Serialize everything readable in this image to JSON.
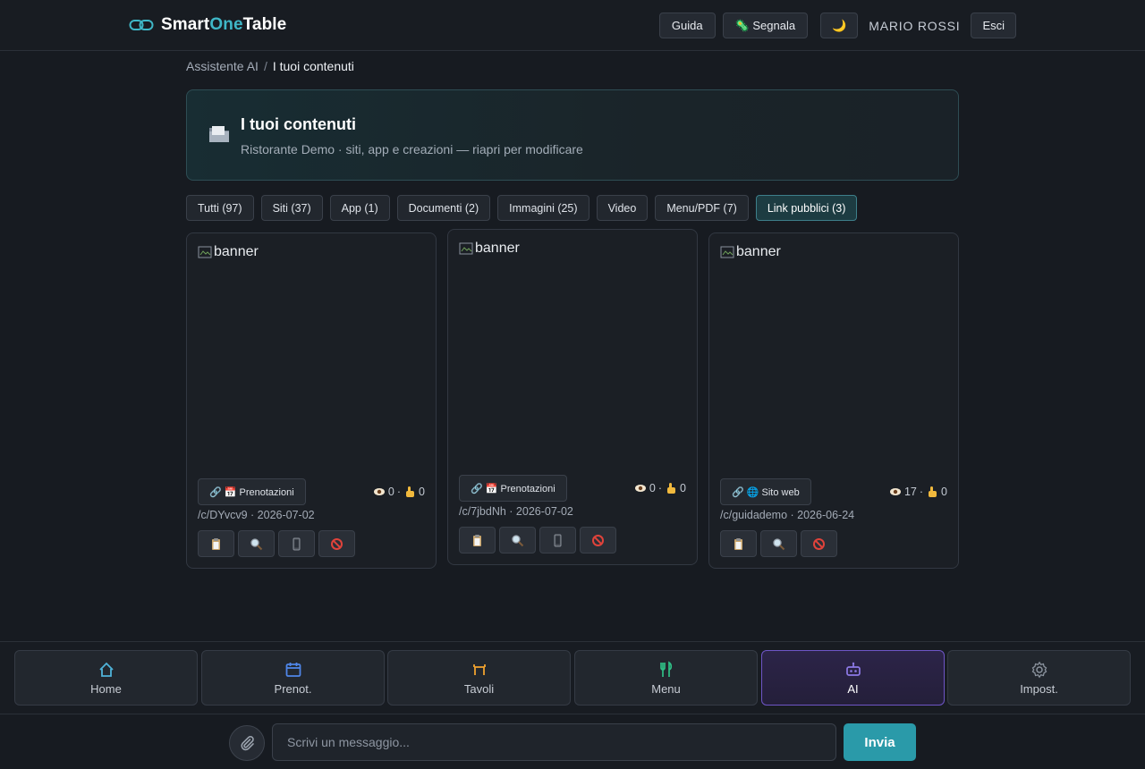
{
  "brand": {
    "part1": "Smart",
    "part2": "One",
    "part3": "Table",
    "logo_icon": "link-logo-icon"
  },
  "header": {
    "guide_label": "Guida",
    "report_label": "🦠 Segnala",
    "theme_icon": "🌙",
    "username": "MARIO ROSSI",
    "logout_label": "Esci"
  },
  "breadcrumb": {
    "parent": "Assistente AI",
    "separator": "/",
    "current": "I tuoi contenuti"
  },
  "hero": {
    "icon": "folder-icon",
    "title": "I tuoi contenuti",
    "subtitle": "Ristorante Demo · siti, app e creazioni — riapri per modificare"
  },
  "filters": [
    {
      "label": "Tutti (97)",
      "active": false
    },
    {
      "label": "Siti (37)",
      "active": false
    },
    {
      "label": "App (1)",
      "active": false
    },
    {
      "label": "Documenti (2)",
      "active": false
    },
    {
      "label": "Immagini (25)",
      "active": false
    },
    {
      "label": "Video",
      "active": false
    },
    {
      "label": "Menu/PDF (7)",
      "active": false
    },
    {
      "label": "Link pubblici (3)",
      "active": true
    }
  ],
  "cards": [
    {
      "banner_alt": "banner",
      "type_label": "🔗 📅 Prenotazioni",
      "views": "0",
      "clicks": "0",
      "stats_sep": "·",
      "meta": "/c/DYvcv9 · 2026-07-02",
      "actions": [
        "copy-icon",
        "preview-icon",
        "qr-icon",
        "disable-icon"
      ]
    },
    {
      "banner_alt": "banner",
      "type_label": "🔗 📅 Prenotazioni",
      "views": "0",
      "clicks": "0",
      "stats_sep": "·",
      "meta": "/c/7jbdNh · 2026-07-02",
      "actions": [
        "copy-icon",
        "preview-icon",
        "qr-icon",
        "disable-icon"
      ]
    },
    {
      "banner_alt": "banner",
      "type_label": "🔗 🌐 Sito web",
      "views": "17",
      "clicks": "0",
      "stats_sep": "·",
      "meta": "/c/guidademo · 2026-06-24",
      "actions": [
        "copy-icon",
        "preview-icon",
        "disable-icon"
      ]
    }
  ],
  "bottom_nav": [
    {
      "label": "Home",
      "icon": "home-icon",
      "active": false
    },
    {
      "label": "Prenot.",
      "icon": "calendar-icon",
      "active": false
    },
    {
      "label": "Tavoli",
      "icon": "table-icon",
      "active": false
    },
    {
      "label": "Menu",
      "icon": "fork-knife-icon",
      "active": false
    },
    {
      "label": "AI",
      "icon": "robot-icon",
      "active": true
    },
    {
      "label": "Impost.",
      "icon": "gear-icon",
      "active": false
    }
  ],
  "composer": {
    "placeholder": "Scrivi un messaggio...",
    "send_label": "Invia",
    "attach_icon": "paperclip-icon"
  },
  "colors": {
    "accent": "#2a9aa9",
    "brand_one": "#3fb7c7",
    "ai_active": "#6e55c6",
    "background": "#171b21"
  }
}
